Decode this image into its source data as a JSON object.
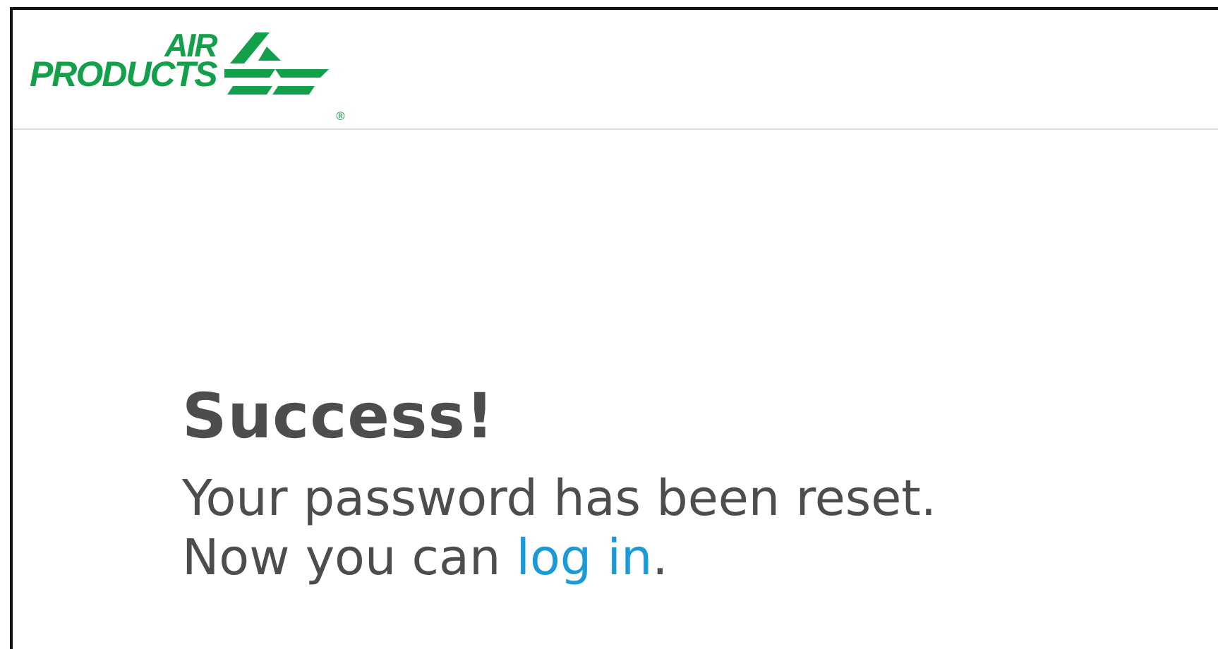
{
  "header": {
    "logo": {
      "line_1": "AIR",
      "line_2": "PRODUCTS",
      "registered": "®"
    }
  },
  "message": {
    "title": "Success!",
    "line_1": "Your password has been reset.",
    "line_2_before": "Now you can",
    "link": "log in",
    "line_2_after": "."
  }
}
